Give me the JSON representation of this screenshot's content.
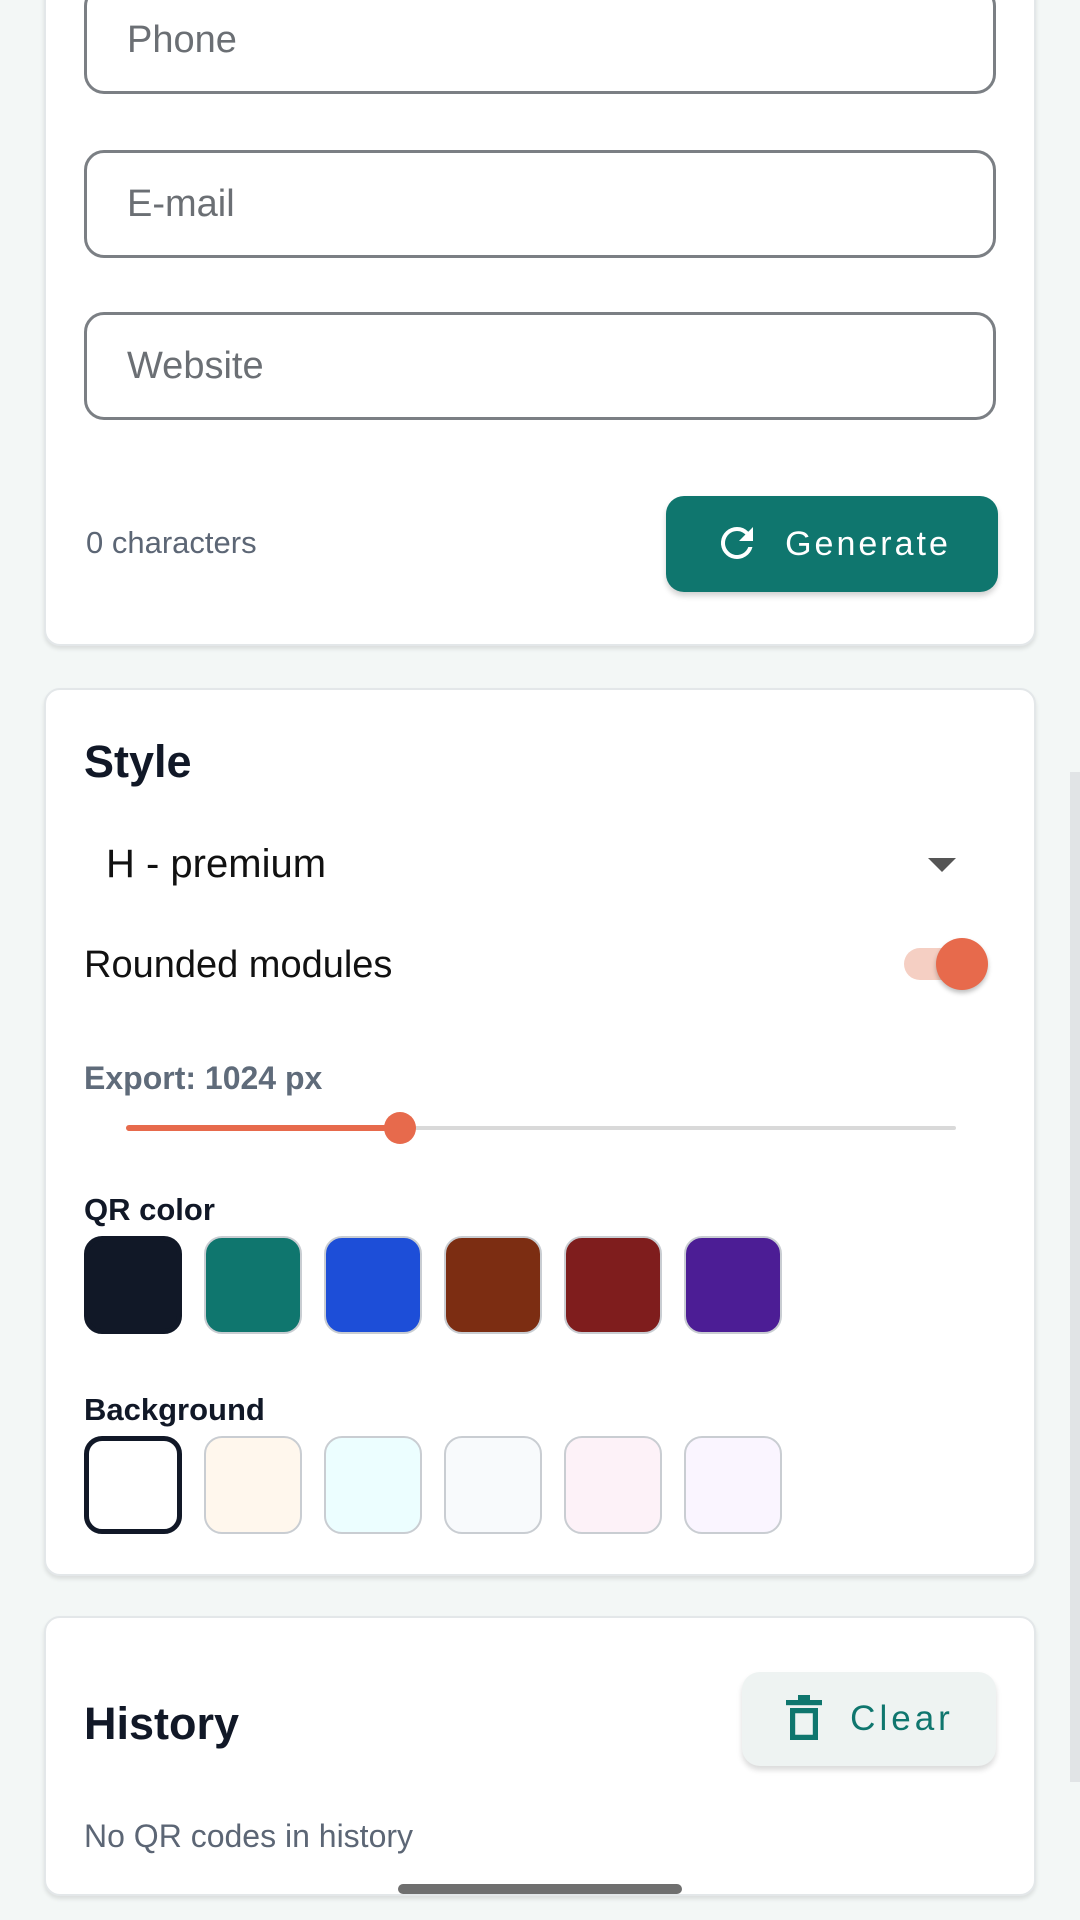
{
  "form": {
    "phone_placeholder": "Phone",
    "email_placeholder": "E-mail",
    "website_placeholder": "Website",
    "char_count": "0 characters",
    "generate_label": "Generate"
  },
  "style": {
    "title": "Style",
    "selected_level": "H - premium",
    "rounded_label": "Rounded modules",
    "rounded_on": true,
    "export_label": "Export: 1024 px",
    "export_fraction": 0.33,
    "qr_color_label": "QR color",
    "qr_colors": [
      "#111827",
      "#0f766e",
      "#1d4ed8",
      "#7c2d12",
      "#7f1d1d",
      "#4c1d95"
    ],
    "qr_selected": 0,
    "background_label": "Background",
    "bg_colors": [
      "#ffffff",
      "#fff7ed",
      "#ecfeff",
      "#f8fafc",
      "#fdf2f8",
      "#faf5ff"
    ],
    "bg_selected": 0,
    "accent": "#e76a4c"
  },
  "history": {
    "title": "History",
    "clear_label": "Clear",
    "empty_text": "No QR codes in history"
  },
  "theme": {
    "primary": "#0f766e"
  }
}
